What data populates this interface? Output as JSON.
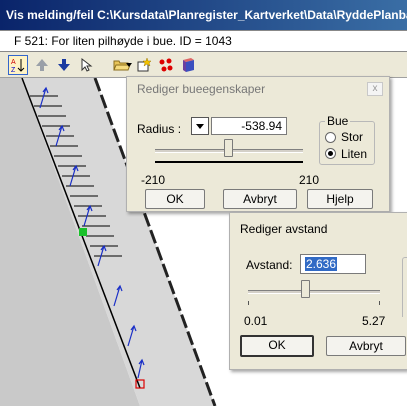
{
  "window": {
    "title": "Vis melding/feil  C:\\Kursdata\\Planregister_Kartverket\\Data\\RyddePlanbase\\re"
  },
  "message": {
    "text": "F 521:  For liten pilhøyde i bue. ID = 1043"
  },
  "toolbar": {
    "icons": [
      "sort-az-icon",
      "arrow-up-icon",
      "arrow-down-icon",
      "cursor-icon",
      "folder-open-icon",
      "dropdown-arrow-icon",
      "star-tool-icon",
      "red-points-icon",
      "book-icon"
    ]
  },
  "dialog_bue": {
    "title": "Rediger bueegenskaper",
    "close": "x",
    "radius_label": "Radius :",
    "radius_value": "-538.94",
    "slider_min": "-210",
    "slider_max": "210",
    "slider_level": 0.45,
    "group_label": "Bue",
    "option_stor": "Stor",
    "option_liten": "Liten",
    "selected": "Liten",
    "ok": "OK",
    "cancel": "Avbryt",
    "help": "Hjelp"
  },
  "dialog_avstand": {
    "title": "Rediger avstand",
    "avstand_label": "Avstand:",
    "avstand_value": "2.636",
    "slider_min": "0.01",
    "slider_max": "5.27",
    "slider_level": 0.5,
    "ok": "OK",
    "cancel": "Avbryt"
  }
}
